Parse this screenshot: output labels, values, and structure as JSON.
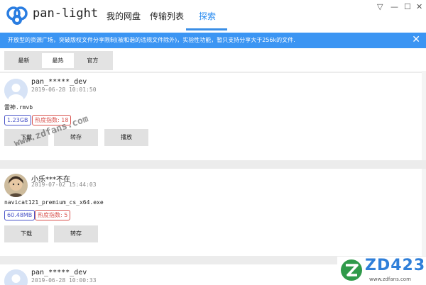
{
  "app": {
    "name": "pan-light"
  },
  "nav": {
    "tabs": [
      {
        "label": "我的网盘"
      },
      {
        "label": "传输列表"
      },
      {
        "label": "探索"
      }
    ]
  },
  "window_controls": {
    "dropdown": "▽",
    "minimize": "—",
    "maximize": "☐",
    "close": "✕"
  },
  "banner": {
    "text": "开放型的资源广场，突破版权文件分享限制(被和谐的违规文件除外)，实验性功能，暂只支持分享大于256k的文件.",
    "close": "✕"
  },
  "filter_tabs": [
    {
      "label": "最新"
    },
    {
      "label": "最热",
      "active": true
    },
    {
      "label": "官方"
    }
  ],
  "posts": [
    {
      "username": "pan_*****_dev",
      "date": "2019-06-28 10:01:50",
      "filename": "雷神.rmvb",
      "size": "1.23GB",
      "heat": "热度指数: 18",
      "buttons": [
        "下载",
        "转存",
        "播放"
      ]
    },
    {
      "username": "小乐***不在",
      "date": "2019-07-02 15:44:03",
      "filename": "navicat121_premium_cs_x64.exe",
      "size": "60.48MB",
      "heat": "热度指数: 5",
      "buttons": [
        "下载",
        "转存"
      ]
    },
    {
      "username": "pan_*****_dev",
      "date": "2019-06-28 10:00:33"
    }
  ],
  "watermark": {
    "text": "www.zdfans.com"
  },
  "corner_logo": {
    "text": "ZD423",
    "sub": "www.zdfans.com"
  },
  "colors": {
    "accent": "#3b95f3",
    "size_badge": "#4b55c8",
    "heat_badge": "#d9534f"
  }
}
